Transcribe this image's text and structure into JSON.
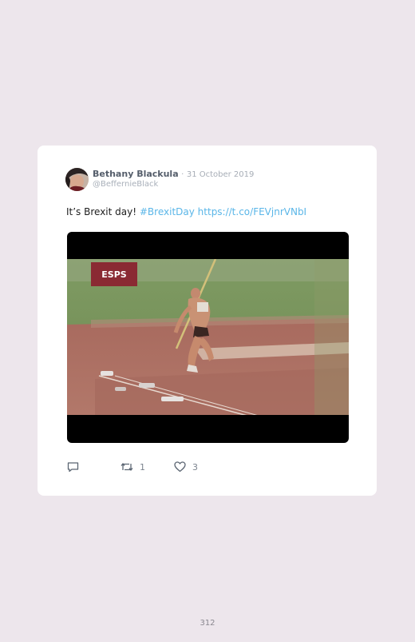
{
  "tweet": {
    "author_name": "Bethany Blackula",
    "separator": "·",
    "date": "31 October 2019",
    "handle": "@BeffernieBlack",
    "text_plain": "It’s Brexit day!",
    "hashtag": "#BrexitDay",
    "link": "https://t.co/FEVjnrVNbI",
    "media": {
      "watermark": "ESPS"
    },
    "actions": {
      "reply_icon": "reply-icon",
      "retweet_icon": "retweet-icon",
      "like_icon": "heart-icon",
      "retweet_count": "1",
      "like_count": "3"
    }
  },
  "page": {
    "number": "312"
  },
  "colors": {
    "background": "#ede6ec",
    "card": "#ffffff",
    "link": "#5ab6e8",
    "author": "#555e6b",
    "meta": "#a9b0ba"
  }
}
